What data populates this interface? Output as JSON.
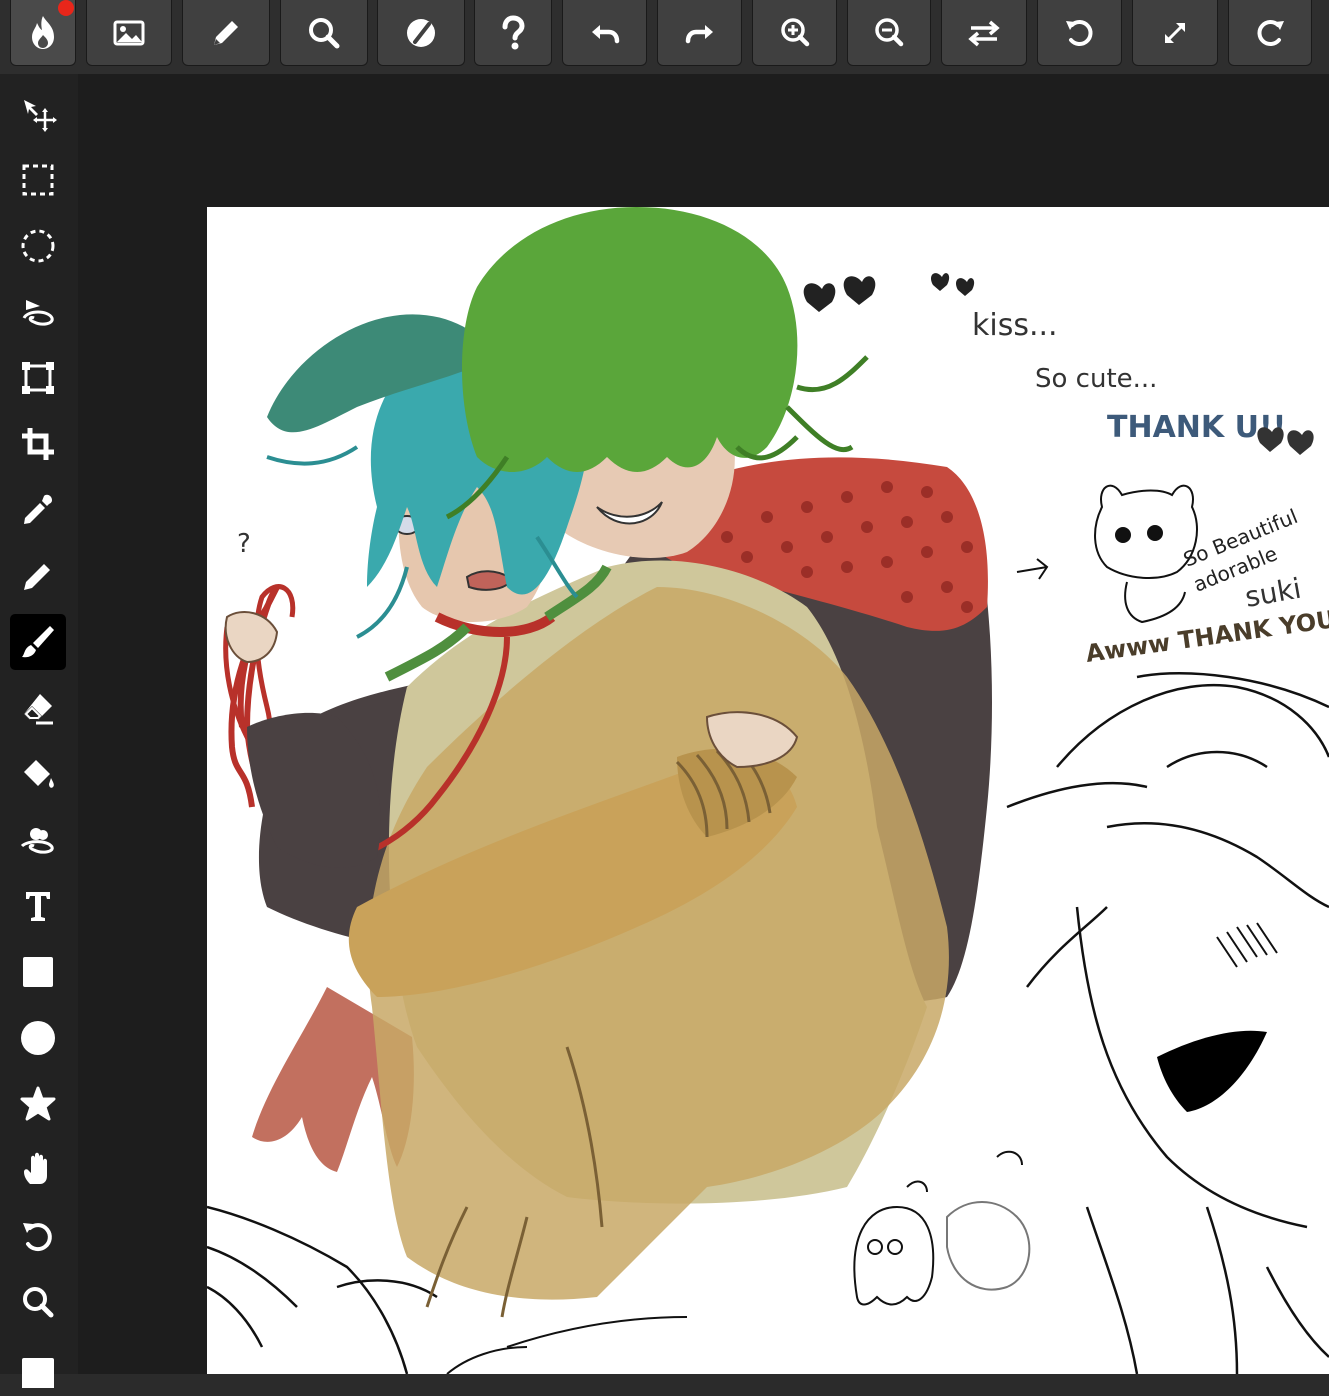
{
  "app": {
    "notification": true,
    "accent_color": "#e8261a"
  },
  "toolbar": {
    "buttons": [
      {
        "name": "app-logo-button",
        "icon": "flame-logo-icon"
      },
      {
        "name": "open-image-button",
        "icon": "image-icon"
      },
      {
        "name": "edit-button",
        "icon": "pencil-icon"
      },
      {
        "name": "search-button",
        "icon": "search-icon"
      },
      {
        "name": "theme-button",
        "icon": "contrast-icon"
      },
      {
        "name": "help-button",
        "icon": "question-icon"
      },
      {
        "name": "undo-button",
        "icon": "undo-icon"
      },
      {
        "name": "redo-button",
        "icon": "redo-icon"
      },
      {
        "name": "zoom-in-button",
        "icon": "zoom-in-icon"
      },
      {
        "name": "zoom-out-button",
        "icon": "zoom-out-icon"
      },
      {
        "name": "swap-button",
        "icon": "swap-arrows-icon"
      },
      {
        "name": "rotate-left-button",
        "icon": "rotate-left-icon"
      },
      {
        "name": "fullscreen-button",
        "icon": "expand-icon"
      },
      {
        "name": "rotate-right-button",
        "icon": "rotate-right-icon"
      }
    ]
  },
  "sidebar": {
    "active_tool": "brush-tool",
    "tools": [
      {
        "name": "move-tool",
        "icon": "move-icon"
      },
      {
        "name": "rect-select-tool",
        "icon": "rect-select-icon"
      },
      {
        "name": "ellipse-select-tool",
        "icon": "ellipse-select-icon"
      },
      {
        "name": "lasso-tool",
        "icon": "lasso-icon"
      },
      {
        "name": "transform-tool",
        "icon": "transform-icon"
      },
      {
        "name": "crop-tool",
        "icon": "crop-icon"
      },
      {
        "name": "eyedropper-tool",
        "icon": "eyedropper-icon"
      },
      {
        "name": "pencil-tool",
        "icon": "pencil-icon"
      },
      {
        "name": "brush-tool",
        "icon": "brush-icon"
      },
      {
        "name": "eraser-tool",
        "icon": "eraser-icon"
      },
      {
        "name": "fill-tool",
        "icon": "paint-bucket-icon"
      },
      {
        "name": "smudge-tool",
        "icon": "smudge-icon"
      },
      {
        "name": "text-tool",
        "icon": "text-icon"
      },
      {
        "name": "rectangle-tool",
        "icon": "square-icon"
      },
      {
        "name": "ellipse-tool",
        "icon": "circle-icon"
      },
      {
        "name": "shape-tool",
        "icon": "star-icon"
      },
      {
        "name": "hand-tool",
        "icon": "hand-icon"
      },
      {
        "name": "rotate-view-tool",
        "icon": "rotate-icon"
      },
      {
        "name": "zoom-tool",
        "icon": "zoom-icon"
      },
      {
        "name": "color-swatch",
        "icon": "swatch-icon"
      }
    ]
  },
  "canvas": {
    "notes": {
      "kiss": "kiss...",
      "so_cute": "So cute...",
      "thank_u": "THANK U!!",
      "so_beautiful": "So Beautiful",
      "adorable": "adorable",
      "suki": "suki",
      "aww_thank_you": "Awww THANK YOU!"
    }
  }
}
